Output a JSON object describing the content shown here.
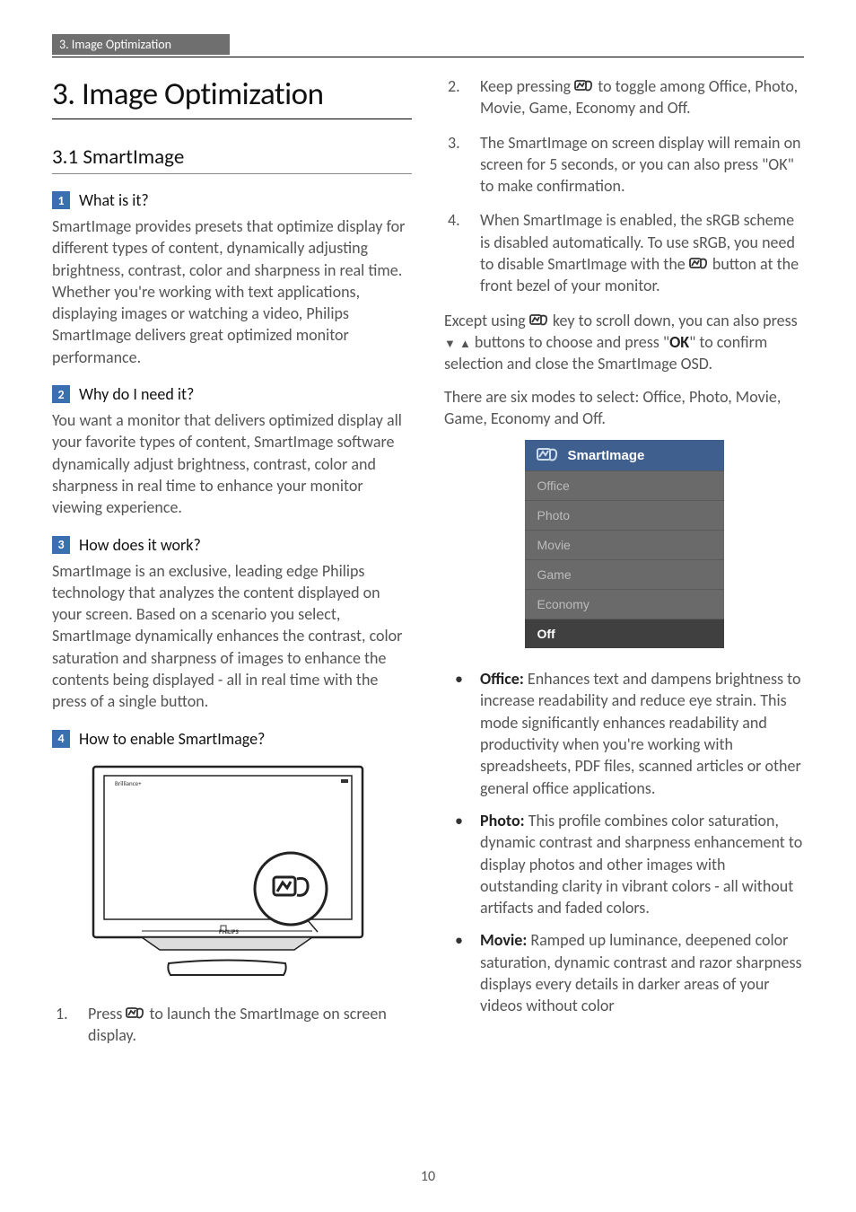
{
  "runningHead": "3. Image Optimization",
  "title": "3.  Image Optimization",
  "section": "3.1  SmartImage",
  "q1": {
    "num": "1",
    "label": "What is it?"
  },
  "p1": "SmartImage provides presets that optimize display for different types of content, dynamically adjusting brightness, contrast, color and sharpness in real time. Whether you're working with text applications, displaying images or watching a video, Philips SmartImage delivers great optimized monitor performance.",
  "q2": {
    "num": "2",
    "label": "Why do I need it?"
  },
  "p2": "You want a monitor that delivers optimized display all your favorite types of content, SmartImage software dynamically adjust brightness, contrast, color and sharpness in real time to enhance your monitor viewing experience.",
  "q3": {
    "num": "3",
    "label": "How does it work?"
  },
  "p3": "SmartImage is an exclusive, leading edge Philips technology that analyzes the content displayed on your screen. Based on a scenario you select, SmartImage dynamically enhances the contrast, color saturation and sharpness of images to enhance the contents being displayed - all in real time with the press of a single button.",
  "q4": {
    "num": "4",
    "label": "How to enable SmartImage?"
  },
  "step1a": "Press ",
  "step1b": " to launch the SmartImage on screen display.",
  "step2a": "Keep pressing ",
  "step2b": " to toggle among Office, Photo, Movie, Game, Economy and Off.",
  "step3": "The SmartImage on screen display will remain on screen for 5 seconds, or you can also press \"OK\" to make confirmation.",
  "step4a": "When SmartImage is enabled, the sRGB scheme is disabled automatically. To use sRGB, you need to disable SmartImage with the ",
  "step4b": " button at the front bezel of your monitor.",
  "exceptA": "Except using ",
  "exceptB": " key to scroll down, you can also press ",
  "exceptC": " buttons to choose and press \"",
  "exceptOK": "OK",
  "exceptD": "\" to confirm selection and close the SmartImage OSD.",
  "modesIntro": "There are six modes to select: Office, Photo, Movie, Game, Economy and Off.",
  "osd": {
    "title": "SmartImage",
    "items": [
      "Office",
      "Photo",
      "Movie",
      "Game",
      "Economy",
      "Off"
    ],
    "selectedIndex": 5
  },
  "bullets": {
    "office": {
      "label": "Office:",
      "text": " Enhances text and dampens brightness to increase readability and reduce eye strain. This mode significantly enhances readability and productivity when you're working with spreadsheets, PDF files, scanned articles or other general office applications."
    },
    "photo": {
      "label": "Photo:",
      "text": " This profile combines color saturation, dynamic contrast and sharpness enhancement to display photos and other images with outstanding clarity in vibrant colors - all without artifacts and faded colors."
    },
    "movie": {
      "label": "Movie:",
      "text": " Ramped up luminance, deepened color saturation, dynamic contrast and razor sharpness displays every details in darker areas of your videos without color"
    }
  },
  "pageNumber": "10"
}
